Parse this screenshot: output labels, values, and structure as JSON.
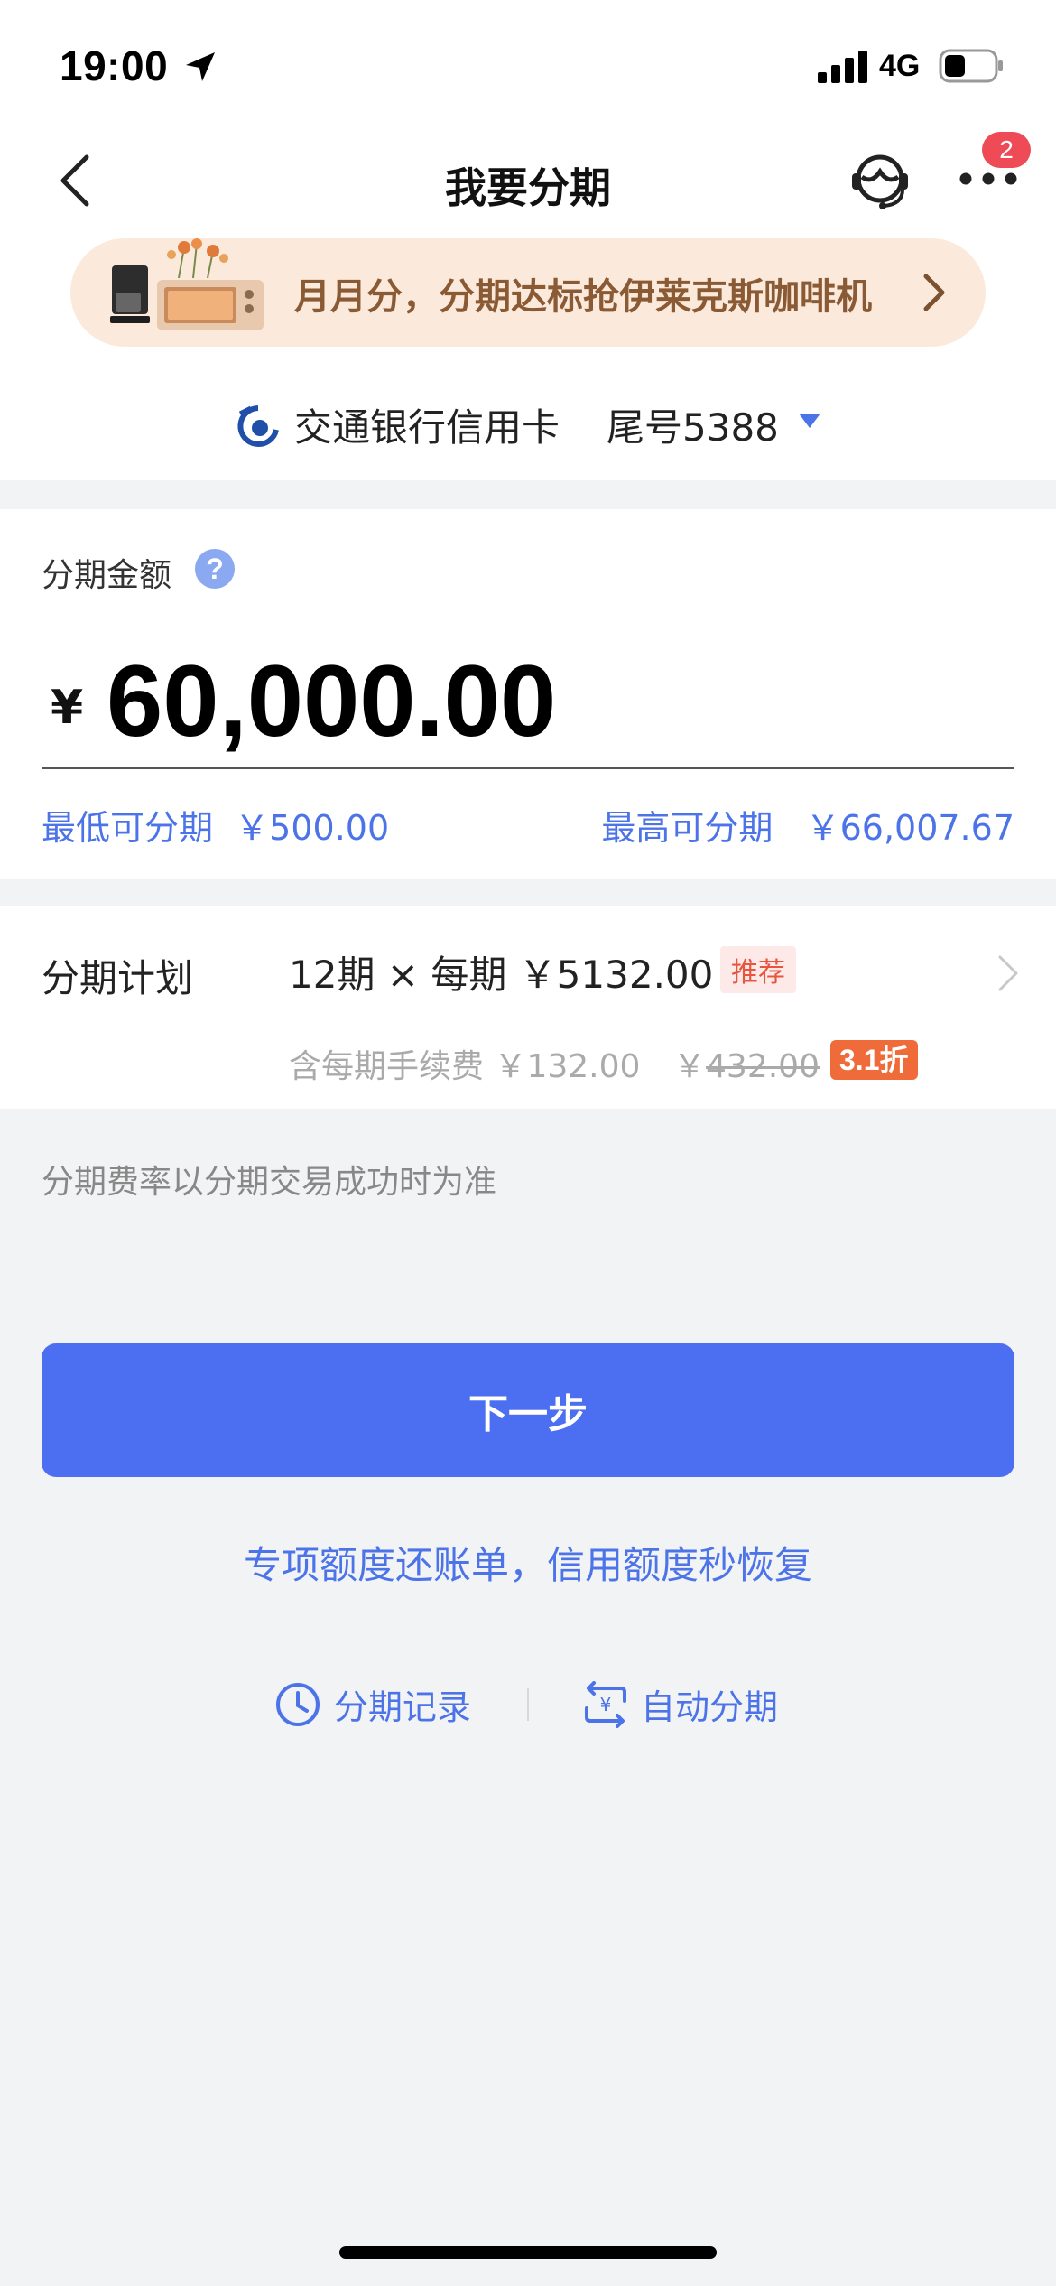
{
  "status_bar": {
    "time": "19:00",
    "network": "4G"
  },
  "nav": {
    "title": "我要分期",
    "badge_count": "2"
  },
  "promo": {
    "text": "月月分，分期达标抢伊莱克斯咖啡机"
  },
  "card": {
    "bank_name": "交通银行信用卡",
    "tail": "尾号5388"
  },
  "amount": {
    "label": "分期金额",
    "help": "?",
    "currency": "¥",
    "value": "60,000.00",
    "min_text": "最低可分期  ￥500.00",
    "max_text": "最高可分期   ￥66,007.67"
  },
  "plan": {
    "label": "分期计划",
    "main": "12期 × 每期 ￥5132.00",
    "tag": "推荐",
    "fee": "含每期手续费 ￥132.00",
    "orig_currency": "￥",
    "orig_fee": "432.00",
    "discount": "3.1折"
  },
  "rate_note": "分期费率以分期交易成功时为准",
  "next_button": "下一步",
  "special_link": "专项额度还账单，信用额度秒恢复",
  "links": {
    "record": "分期记录",
    "auto": "自动分期"
  },
  "colors": {
    "primary": "#4c6ff2",
    "link": "#4c74e8",
    "promo_bg": "#fbeadb",
    "discount": "#ef6b3a",
    "badge": "#ee4b57"
  }
}
